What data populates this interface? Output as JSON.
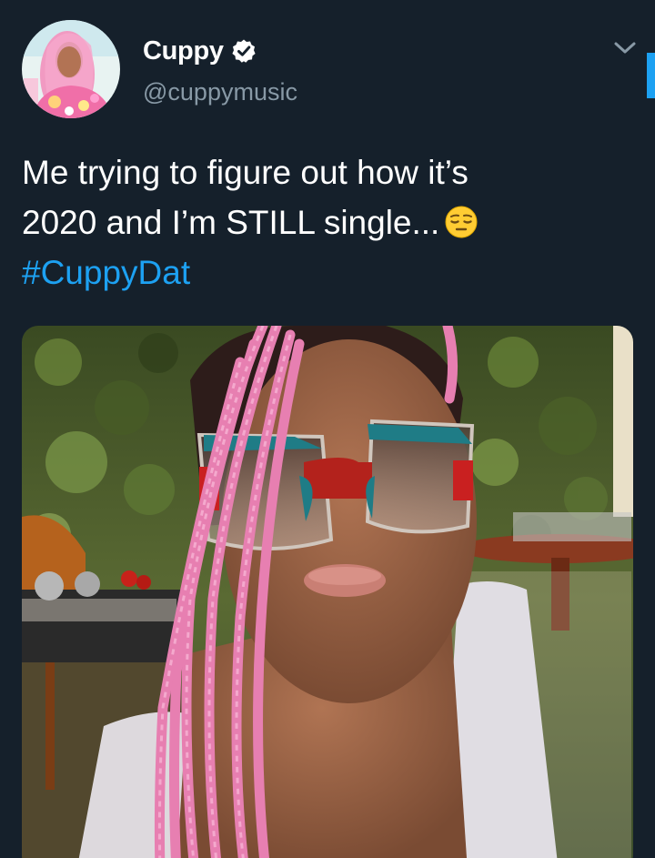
{
  "user": {
    "display_name": "Cuppy",
    "handle": "@cuppymusic",
    "verified": true
  },
  "tweet": {
    "text_line1": "Me trying to figure out how it’s",
    "text_line2": "2020 and I’m STILL single...",
    "emoji": "pensive-face",
    "hashtag": "#CuppyDat"
  },
  "colors": {
    "background": "#15202b",
    "accent": "#1da1f2",
    "secondary_text": "#8899a6"
  },
  "icons": {
    "menu": "chevron-down-icon",
    "verified": "verified-badge-icon"
  }
}
